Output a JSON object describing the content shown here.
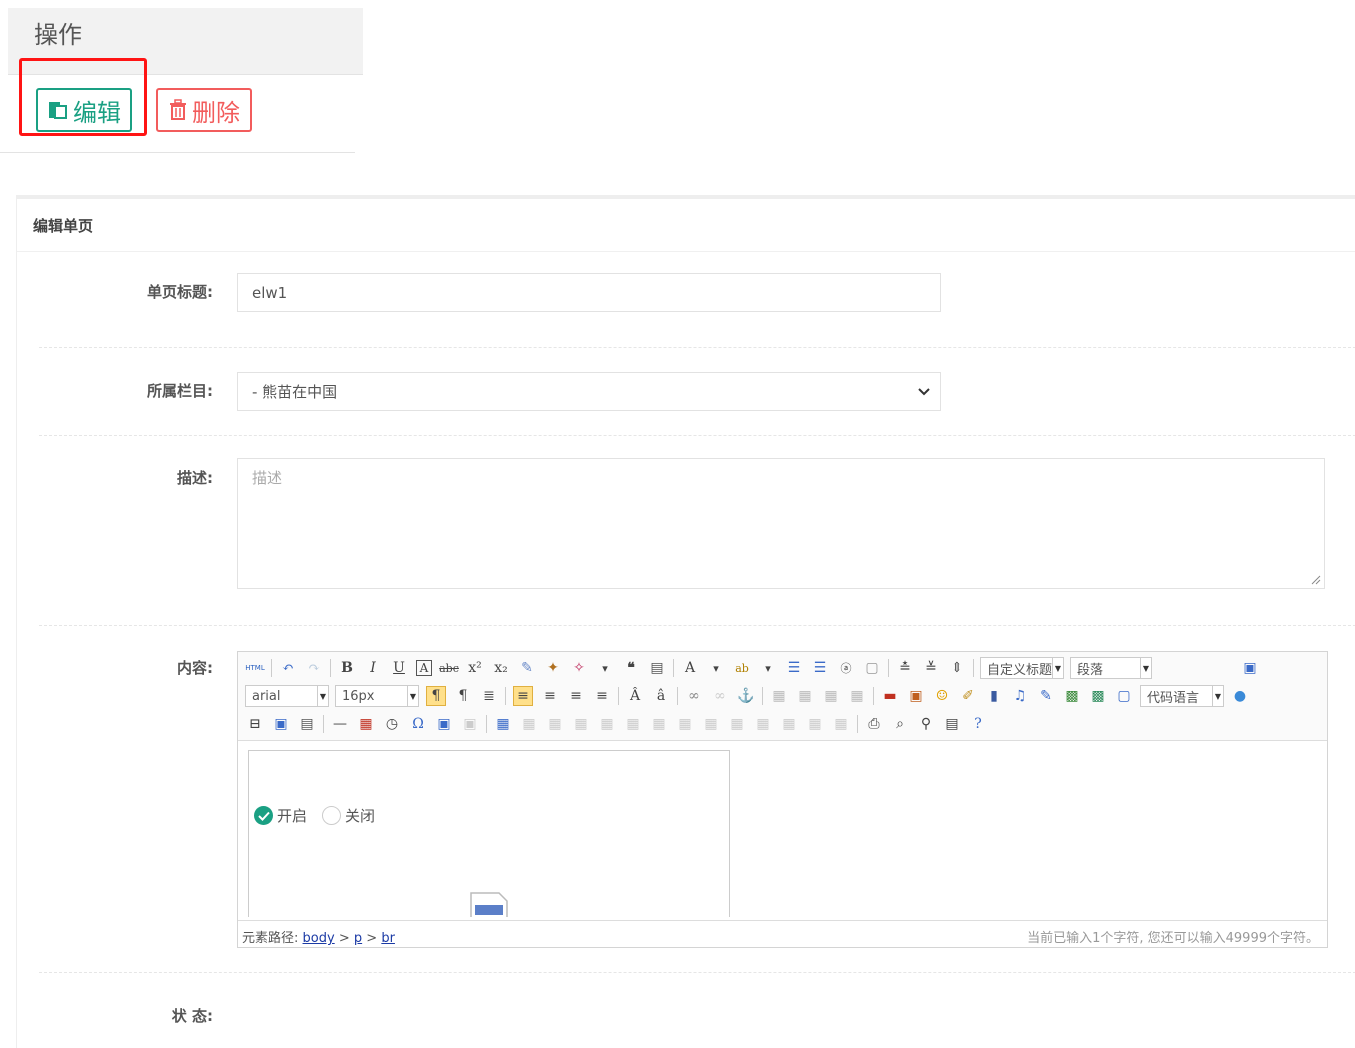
{
  "ops": {
    "header": "操作",
    "edit_label": "编辑",
    "delete_label": "删除",
    "colors": {
      "edit": "#1aa083",
      "delete": "#f25c5c",
      "highlight": "#ff1414"
    }
  },
  "form": {
    "panel_title": "编辑单页",
    "title_label": "单页标题:",
    "title_value": "elw1",
    "category_label": "所属栏目:",
    "category_value": "- 熊苗在中国",
    "desc_label": "描述:",
    "desc_placeholder": "描述",
    "content_label": "内容:",
    "status_label": "状 态:",
    "status_on": "开启",
    "status_off": "关闭",
    "status_selected": "开启"
  },
  "editor": {
    "toolbar": {
      "custom_heading": "自定义标题",
      "paragraph": "段落",
      "font_family": "arial",
      "font_size": "16px",
      "code_language": "代码语言"
    },
    "status": {
      "path_label": "元素路径:",
      "path": [
        "body",
        "p",
        "br"
      ],
      "path_sep": ">",
      "count_text": "当前已输入1个字符, 您还可以输入49999个字符。"
    }
  }
}
